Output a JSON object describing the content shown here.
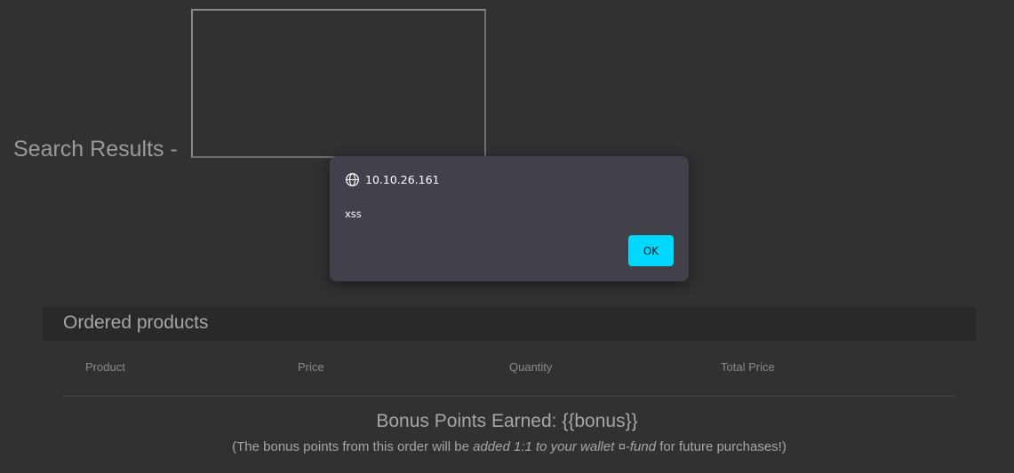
{
  "search": {
    "heading": "Search Results -"
  },
  "alert": {
    "origin": "10.10.26.161",
    "message": "xss",
    "ok_label": "OK",
    "accent_color": "#00d8ff"
  },
  "orders": {
    "title": "Ordered products",
    "columns": [
      "Product",
      "Price",
      "Quantity",
      "Total Price"
    ]
  },
  "bonus": {
    "title": "Bonus Points Earned: {{bonus}}",
    "note_prefix": "(The bonus points from this order will be",
    "note_emphasis": "added 1:1 to your wallet ¤-fund",
    "note_suffix": "for future purchases!)"
  }
}
